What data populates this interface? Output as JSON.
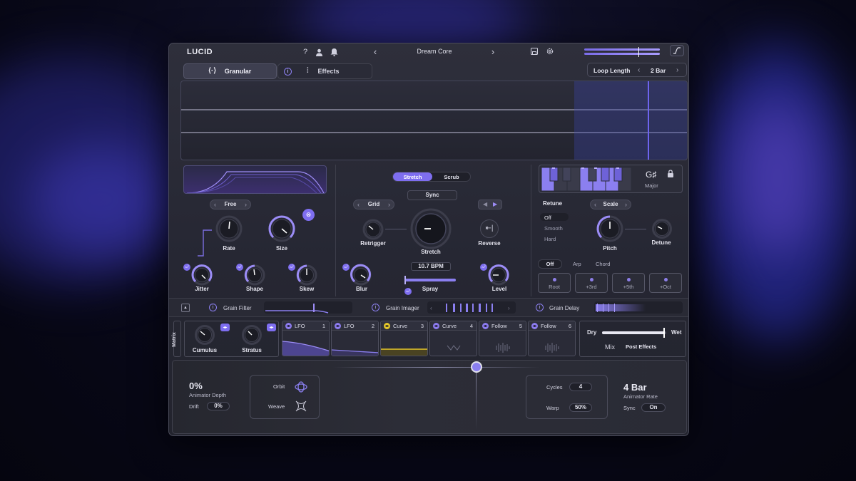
{
  "app": {
    "logo": "LUCID"
  },
  "topbar": {
    "preset_name": "Dream Core"
  },
  "tabs": {
    "granular": "Granular",
    "effects": "Effects"
  },
  "loop": {
    "label": "Loop Length",
    "value": "2 Bar"
  },
  "colors": {
    "accent": "#8b7ff0",
    "panel": "#2a2b36",
    "yellow": "#e6c82a"
  },
  "playmode": {
    "stretch": "Stretch",
    "scrub": "Scrub",
    "sync": "Sync"
  },
  "grain": {
    "mode": "Free",
    "grid": "Grid",
    "rate": "Rate",
    "size": "Size",
    "jitter": "Jitter",
    "shape": "Shape",
    "skew": "Skew",
    "retrigger": "Retrigger",
    "stretch_label": "Stretch",
    "reverse": "Reverse",
    "blur": "Blur",
    "bpm": "10.7 BPM",
    "spray": "Spray",
    "level": "Level"
  },
  "pitch": {
    "key": "G♯",
    "scale_name": "Major",
    "retune": "Retune",
    "retune_options": [
      "Off",
      "Smooth",
      "Hard"
    ],
    "scale": "Scale",
    "pitch_label": "Pitch",
    "detune": "Detune",
    "chord_modes": [
      "Off",
      "Arp",
      "Chord"
    ],
    "intervals": [
      "Root",
      "+3rd",
      "+5th",
      "+Oct"
    ]
  },
  "fx": {
    "grain_filter": "Grain Filter",
    "grain_imager": "Grain Imager",
    "grain_delay": "Grain Delay"
  },
  "matrix": {
    "label": "Matrix",
    "cumulus": "Cumulus",
    "stratus": "Stratus",
    "modulators": [
      {
        "name": "LFO",
        "num": "1"
      },
      {
        "name": "LFO",
        "num": "2"
      },
      {
        "name": "Curve",
        "num": "3"
      },
      {
        "name": "Curve",
        "num": "4"
      },
      {
        "name": "Follow",
        "num": "5"
      },
      {
        "name": "Follow",
        "num": "6"
      }
    ]
  },
  "mix": {
    "dry": "Dry",
    "wet": "Wet",
    "mix_label": "Mix",
    "post": "Post Effects",
    "value": 0.97
  },
  "animator": {
    "depth_value": "0%",
    "depth_label": "Animator Depth",
    "drift_label": "Drift",
    "drift_value": "0%",
    "orbit": "Orbit",
    "weave": "Weave",
    "cycles_label": "Cycles",
    "cycles_value": "4",
    "warp_label": "Warp",
    "warp_value": "50%",
    "rate_value": "4 Bar",
    "rate_label": "Animator Rate",
    "sync_label": "Sync",
    "sync_value": "On"
  }
}
